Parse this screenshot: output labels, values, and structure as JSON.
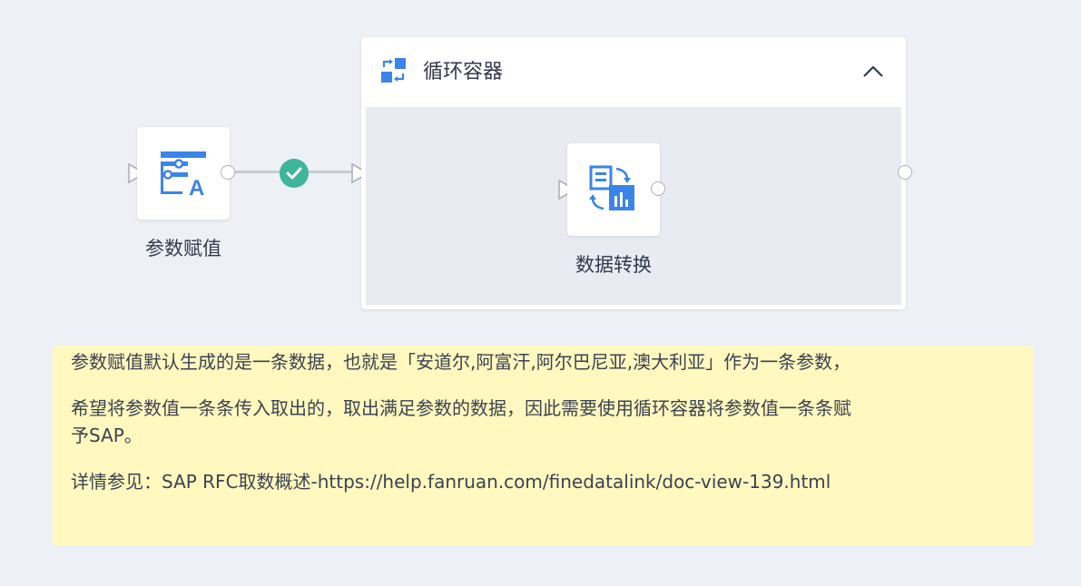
{
  "nodes": {
    "param": {
      "label": "参数赋值",
      "icon": "parameter-assign-icon"
    },
    "container": {
      "title": "循环容器",
      "icon": "loop-container-icon",
      "collapse_icon": "chevron-up-icon"
    },
    "transform": {
      "label": "数据转换",
      "icon": "data-transform-icon"
    }
  },
  "edge": {
    "status_icon": "check-circle-icon",
    "status_color": "#3fb59a"
  },
  "note": {
    "line1": "参数赋值默认生成的是一条数据，也就是「安道尔,阿富汗,阿尔巴尼亚,澳大利亚」作为一条参数，",
    "line2a": "希望将参数值一条条传入取出的，取出满足参数的数据，因此需要使用循环容器将参数值一条条赋",
    "line2b": "予SAP。",
    "line3": "详情参见：SAP RFC取数概述-https://help.fanruan.com/finedatalink/doc-view-139.html"
  },
  "colors": {
    "accent": "#3b84e8",
    "background": "#edf0f5",
    "note_bg": "#fff8bf"
  }
}
